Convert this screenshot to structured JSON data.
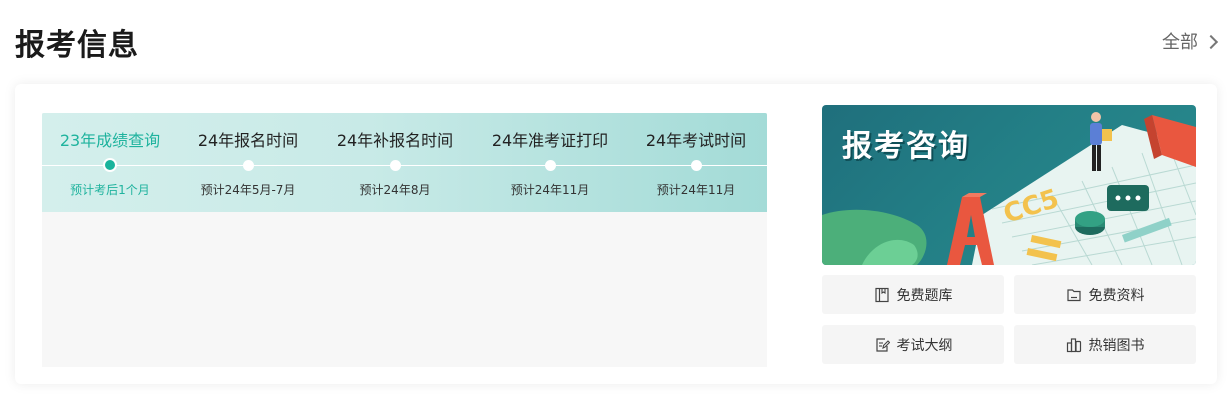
{
  "header": {
    "title": "报考信息",
    "more_label": "全部"
  },
  "timeline": {
    "steps": [
      {
        "title": "23年成绩查询",
        "date": "预计考后1个月",
        "active": true
      },
      {
        "title": "24年报名时间",
        "date": "预计24年5月-7月",
        "active": false
      },
      {
        "title": "24年补报名时间",
        "date": "预计24年8月",
        "active": false
      },
      {
        "title": "24年准考证打印",
        "date": "预计24年11月",
        "active": false
      },
      {
        "title": "24年考试时间",
        "date": "预计24年11月",
        "active": false
      }
    ]
  },
  "banner": {
    "title": "报考咨询"
  },
  "quick_links": [
    {
      "label": "免费题库",
      "icon": "book-icon"
    },
    {
      "label": "免费资料",
      "icon": "folder-icon"
    },
    {
      "label": "考试大纲",
      "icon": "edit-document-icon"
    },
    {
      "label": "热销图书",
      "icon": "books-icon"
    }
  ],
  "colors": {
    "accent": "#19b39c",
    "banner_bg": "#237f86",
    "banner_orange": "#e9573f",
    "banner_yellow": "#f3c24d"
  }
}
